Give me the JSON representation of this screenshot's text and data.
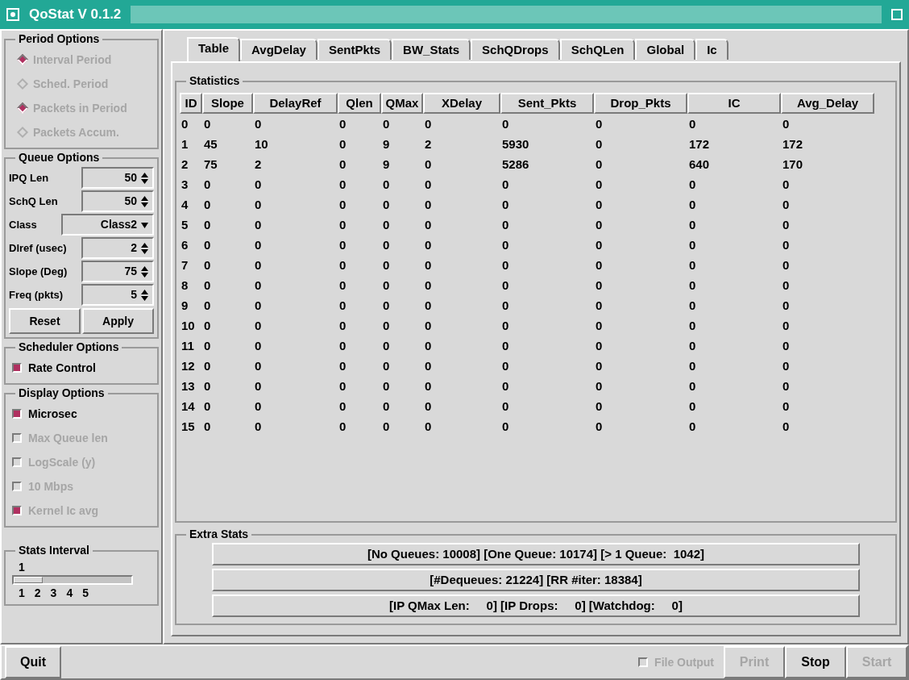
{
  "window": {
    "title": "QoStat V 0.1.2"
  },
  "period_options": {
    "title": "Period Options",
    "items": [
      {
        "label": "Interval Period",
        "selected": true,
        "disabled": true
      },
      {
        "label": "Sched. Period",
        "selected": false,
        "disabled": true
      },
      {
        "label": "Packets in Period",
        "selected": true,
        "disabled": true
      },
      {
        "label": "Packets Accum.",
        "selected": false,
        "disabled": true
      }
    ]
  },
  "queue_options": {
    "title": "Queue Options",
    "fields": [
      {
        "kind": "spinner",
        "label": "IPQ Len",
        "value": "50"
      },
      {
        "kind": "spinner",
        "label": "SchQ Len",
        "value": "50"
      },
      {
        "kind": "dropdown",
        "label": "Class",
        "value": "Class2"
      },
      {
        "kind": "spinner",
        "label": "Dlref (usec)",
        "value": "2"
      },
      {
        "kind": "spinner",
        "label": "Slope (Deg)",
        "value": "75"
      },
      {
        "kind": "spinner",
        "label": "Freq (pkts)",
        "value": "5"
      }
    ],
    "buttons": [
      "Reset",
      "Apply"
    ]
  },
  "scheduler_options": {
    "title": "Scheduler Options",
    "items": [
      {
        "label": "Rate Control",
        "checked": true,
        "disabled": false
      }
    ]
  },
  "display_options": {
    "title": "Display Options",
    "items": [
      {
        "label": "Microsec",
        "checked": true,
        "disabled": false
      },
      {
        "label": "Max Queue len",
        "checked": false,
        "disabled": true
      },
      {
        "label": "LogScale (y)",
        "checked": false,
        "disabled": true
      },
      {
        "label": "10 Mbps",
        "checked": false,
        "disabled": true
      },
      {
        "label": "Kernel Ic avg",
        "checked": true,
        "disabled": true
      }
    ]
  },
  "stats_interval": {
    "title": "Stats Interval",
    "value": "1",
    "level": 0,
    "ticks": [
      "1",
      "2",
      "3",
      "4",
      "5"
    ]
  },
  "tabs": [
    {
      "label": "Table",
      "selected": true
    },
    {
      "label": "AvgDelay",
      "selected": false
    },
    {
      "label": "SentPkts",
      "selected": false
    },
    {
      "label": "BW_Stats",
      "selected": false
    },
    {
      "label": "SchQDrops",
      "selected": false
    },
    {
      "label": "SchQLen",
      "selected": false
    },
    {
      "label": "Global",
      "selected": false
    },
    {
      "label": "Ic",
      "selected": false
    }
  ],
  "statistics": {
    "title": "Statistics",
    "columns": [
      "ID",
      "Slope",
      "DelayRef",
      "Qlen",
      "QMax",
      "XDelay",
      "Sent_Pkts",
      "Drop_Pkts",
      "IC",
      "Avg_Delay"
    ],
    "rows": [
      [
        "0",
        "0",
        "0",
        "0",
        "0",
        "0",
        "0",
        "0",
        "0",
        "0"
      ],
      [
        "1",
        "45",
        "10",
        "0",
        "9",
        "2",
        "5930",
        "0",
        "172",
        "172"
      ],
      [
        "2",
        "75",
        "2",
        "0",
        "9",
        "0",
        "5286",
        "0",
        "640",
        "170"
      ],
      [
        "3",
        "0",
        "0",
        "0",
        "0",
        "0",
        "0",
        "0",
        "0",
        "0"
      ],
      [
        "4",
        "0",
        "0",
        "0",
        "0",
        "0",
        "0",
        "0",
        "0",
        "0"
      ],
      [
        "5",
        "0",
        "0",
        "0",
        "0",
        "0",
        "0",
        "0",
        "0",
        "0"
      ],
      [
        "6",
        "0",
        "0",
        "0",
        "0",
        "0",
        "0",
        "0",
        "0",
        "0"
      ],
      [
        "7",
        "0",
        "0",
        "0",
        "0",
        "0",
        "0",
        "0",
        "0",
        "0"
      ],
      [
        "8",
        "0",
        "0",
        "0",
        "0",
        "0",
        "0",
        "0",
        "0",
        "0"
      ],
      [
        "9",
        "0",
        "0",
        "0",
        "0",
        "0",
        "0",
        "0",
        "0",
        "0"
      ],
      [
        "10",
        "0",
        "0",
        "0",
        "0",
        "0",
        "0",
        "0",
        "0",
        "0"
      ],
      [
        "11",
        "0",
        "0",
        "0",
        "0",
        "0",
        "0",
        "0",
        "0",
        "0"
      ],
      [
        "12",
        "0",
        "0",
        "0",
        "0",
        "0",
        "0",
        "0",
        "0",
        "0"
      ],
      [
        "13",
        "0",
        "0",
        "0",
        "0",
        "0",
        "0",
        "0",
        "0",
        "0"
      ],
      [
        "14",
        "0",
        "0",
        "0",
        "0",
        "0",
        "0",
        "0",
        "0",
        "0"
      ],
      [
        "15",
        "0",
        "0",
        "0",
        "0",
        "0",
        "0",
        "0",
        "0",
        "0"
      ]
    ]
  },
  "extra_stats": {
    "title": "Extra Stats",
    "lines": [
      "[No Queues: 10008] [One Queue: 10174] [> 1 Queue:  1042]",
      "[#Dequeues: 21224] [RR #iter: 18384]",
      "[IP QMax Len:     0] [IP Drops:     0] [Watchdog:     0]"
    ]
  },
  "bottom_bar": {
    "quit": "Quit",
    "file_output": {
      "label": "File Output",
      "checked": false,
      "disabled": true
    },
    "buttons": [
      {
        "label": "Print",
        "disabled": true
      },
      {
        "label": "Stop",
        "disabled": false
      },
      {
        "label": "Start",
        "disabled": true
      }
    ]
  }
}
